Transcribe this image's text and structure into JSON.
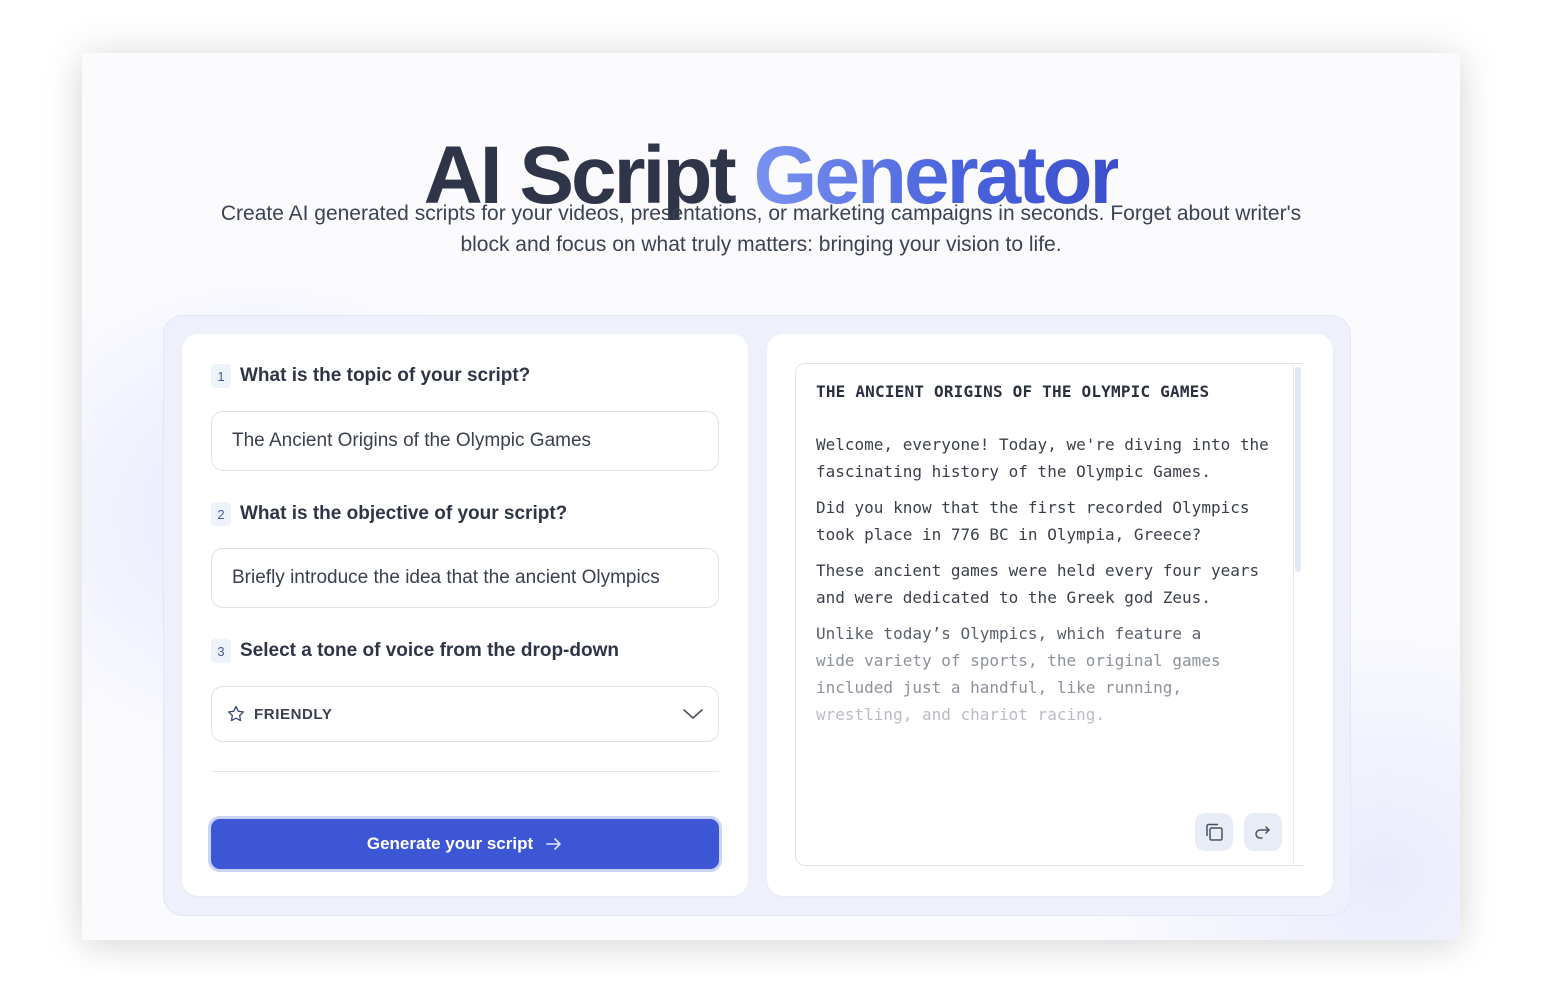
{
  "header": {
    "title_main": "AI Script",
    "title_accent": "Generator",
    "subtitle": "Create AI generated scripts for your videos, presentations, or marketing campaigns in seconds. Forget about writer's block and focus on what truly matters: bringing your vision to life."
  },
  "form": {
    "steps": [
      {
        "number": "1",
        "label": "What is the topic of your script?"
      },
      {
        "number": "2",
        "label": "What is the objective of your script?"
      },
      {
        "number": "3",
        "label": "Select a tone of voice from the drop-down"
      }
    ],
    "topic_value": "The Ancient Origins of the Olympic Games",
    "objective_value": "Briefly introduce the idea that the ancient Olympics",
    "tone": {
      "selected": "FRIENDLY",
      "icon": "star-icon"
    },
    "generate_label": "Generate your script"
  },
  "output": {
    "title": "THE ANCIENT ORIGINS OF THE OLYMPIC GAMES",
    "paragraphs": [
      "Welcome, everyone! Today, we're diving into the fascinating history of the Olympic Games.",
      "Did you know that the first recorded Olympics took place in 776 BC in Olympia, Greece?",
      "These ancient games were held every four years and were dedicated to the Greek god Zeus.",
      "Unlike today’s Olympics, which feature a",
      "wide variety of sports, the original games",
      "included just a handful, like running,",
      "wrestling, and chariot racing."
    ],
    "actions": {
      "copy_icon": "copy-icon",
      "share_icon": "share-icon"
    }
  },
  "colors": {
    "accent": "#3d56d6",
    "title_dark": "#2e3548",
    "gradient_start": "#7a93f0",
    "gradient_end": "#3c4fcb"
  }
}
